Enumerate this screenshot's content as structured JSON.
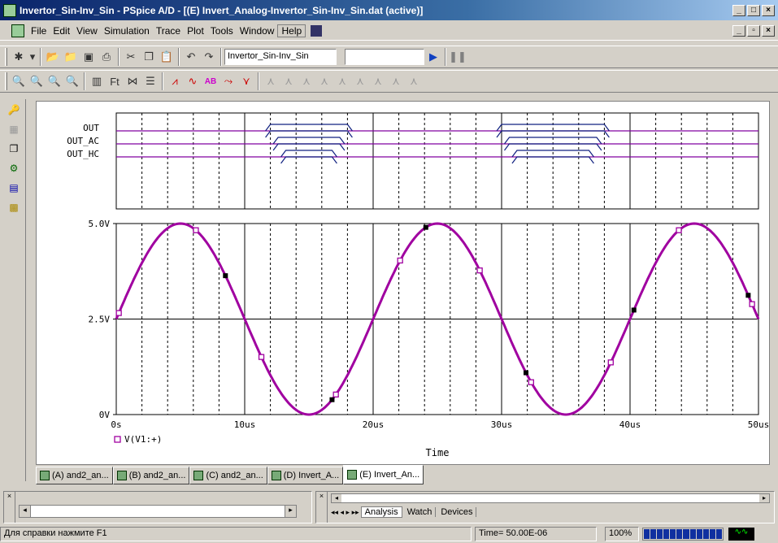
{
  "window": {
    "title": "Invertor_Sin-Inv_Sin - PSpice A/D - [(E) Invert_Analog-Invertor_Sin-Inv_Sin.dat (active)]",
    "controls": [
      "_",
      "□",
      "×"
    ]
  },
  "menu": [
    "File",
    "Edit",
    "View",
    "Simulation",
    "Trace",
    "Plot",
    "Tools",
    "Window",
    "Help"
  ],
  "toolbar": {
    "profile": "Invertor_Sin-Inv_Sin",
    "search": ""
  },
  "digital": {
    "signals": [
      "OUT",
      "OUT_AC",
      "OUT_HC"
    ]
  },
  "chart_data": {
    "type": "line",
    "xlabel": "Time",
    "xticks": [
      "0s",
      "10us",
      "20us",
      "30us",
      "40us",
      "50us"
    ],
    "yticks": [
      "0V",
      "2.5V",
      "5.0V"
    ],
    "xlim": [
      0,
      50
    ],
    "ylim": [
      0,
      5
    ],
    "series": [
      {
        "name": "V(V1:+)",
        "x": [
          0,
          2,
          4,
          5,
          6,
          8,
          10,
          12,
          14,
          15,
          16,
          18,
          20,
          22,
          24,
          25,
          26,
          28,
          30,
          32,
          34,
          35,
          36,
          38,
          40,
          42,
          44,
          45,
          46,
          48,
          50
        ],
        "values": [
          2.5,
          3.97,
          4.88,
          5.0,
          4.88,
          3.97,
          2.5,
          1.03,
          0.12,
          0.0,
          0.12,
          1.03,
          2.5,
          3.97,
          4.88,
          5.0,
          4.88,
          3.97,
          2.5,
          1.03,
          0.12,
          0.0,
          0.12,
          1.03,
          2.5,
          3.97,
          4.88,
          5.0,
          4.88,
          3.97,
          2.5
        ]
      }
    ],
    "color": "#a000a0"
  },
  "tabs": [
    "(A) and2_an...",
    "(B) and2_an...",
    "(C) and2_an...",
    "(D) Invert_A...",
    "(E) Invert_An..."
  ],
  "output_tabs": [
    "Analysis",
    "Watch",
    "Devices"
  ],
  "status": {
    "help": "Для справки нажмите F1",
    "time": "Time= 50.00E-06",
    "zoom": "100%"
  }
}
